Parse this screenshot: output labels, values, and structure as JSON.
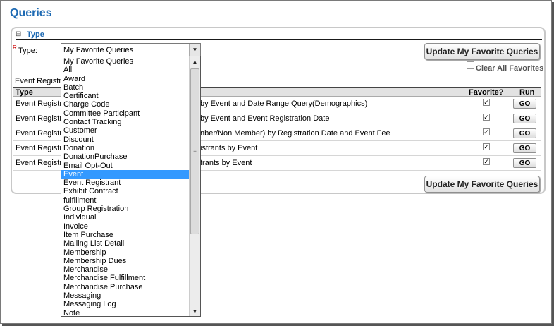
{
  "page": {
    "title": "Queries"
  },
  "panel": {
    "header": "Type",
    "header_icon": "collapse-icon"
  },
  "type_field": {
    "required_mark": "R",
    "label": "Type:",
    "selected_value": "My Favorite Queries"
  },
  "buttons": {
    "update_top": "Update My Favorite Queries",
    "update_bottom": "Update My Favorite Queries"
  },
  "clear_all_label": "Clear All Favorites",
  "section_label": "Event Registra",
  "table": {
    "columns": {
      "type": "Type",
      "favorite": "Favorite?",
      "run": "Run"
    },
    "rows": [
      {
        "type": "Event Registra",
        "description": "by Event and Date Range Query(Demographics)",
        "favorite": true,
        "run": "GO"
      },
      {
        "type": "Event Registra",
        "description": "by Event and Event Registration Date",
        "favorite": true,
        "run": "GO"
      },
      {
        "type": "Event Registra",
        "description": "nber/Non Member) by Registration Date and Event Fee",
        "favorite": true,
        "run": "GO"
      },
      {
        "type": "Event Registra",
        "description": "istrants by Event",
        "favorite": true,
        "run": "GO"
      },
      {
        "type": "Event Registra",
        "description": "trants by Event",
        "favorite": true,
        "run": "GO"
      }
    ]
  },
  "dropdown": {
    "selected": "Event",
    "options": [
      "My Favorite Queries",
      "All",
      "Award",
      "Batch",
      "Certificant",
      "Charge Code",
      "Committee Participant",
      "Contact Tracking",
      "Customer",
      "Discount",
      "Donation",
      "DonationPurchase",
      "Email Opt-Out",
      "Event",
      "Event Registrant",
      "Exhibit Contract",
      "fulfillment",
      "Group Registration",
      "Individual",
      "Invoice",
      "Item Purchase",
      "Mailing List Detail",
      "Membership",
      "Membership Dues",
      "Merchandise",
      "Merchandise Fulfillment",
      "Merchandise Purchase",
      "Messaging",
      "Messaging Log",
      "Note"
    ]
  },
  "glyphs": {
    "check": "✓",
    "arrow_down": "▼",
    "arrow_up": "▲",
    "grip": "≡"
  },
  "icons": {
    "collapse": "collapse-icon",
    "dropdown_arrow": "chevron-down-icon",
    "scroll_up": "scroll-up-icon",
    "scroll_down": "scroll-down-icon"
  },
  "colors": {
    "title_blue": "#1e6ab3",
    "selection": "#3399ff",
    "required": "#cc0000"
  }
}
